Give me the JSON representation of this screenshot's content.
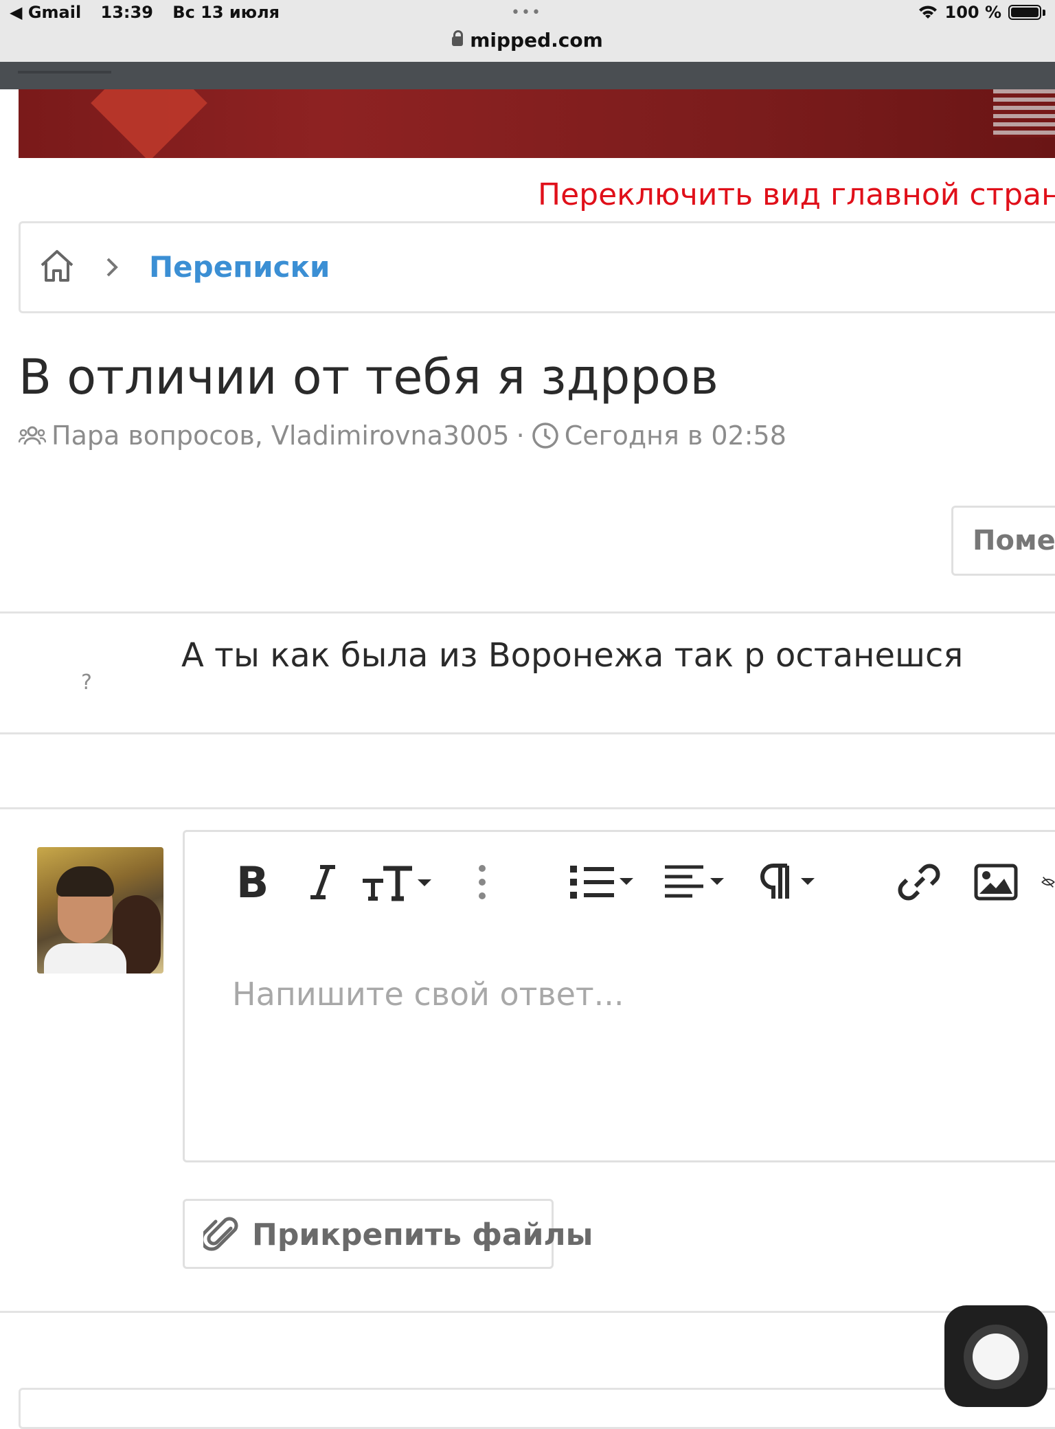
{
  "status_bar": {
    "back_app": "◀ Gmail",
    "time": "13:39",
    "date": "Вс 13 июля",
    "dots": "•••",
    "battery": "100 %"
  },
  "browser": {
    "url": "mipped.com"
  },
  "header": {
    "switch_view_link": "Переключить вид главной стран"
  },
  "breadcrumb": {
    "item": "Переписки"
  },
  "conversation": {
    "title": "В отличии от тебя я здрров",
    "participants": "Пара вопросов, Vladimirovna3005",
    "separator": "·",
    "time": "Сегодня в 02:58",
    "mark_button": "Помет"
  },
  "message": {
    "avatar_placeholder": "?",
    "text": "А ты как была из Воронежа так р останешся"
  },
  "reply": {
    "placeholder": "Напишите свой ответ...",
    "attach_button": "Прикрепить файлы",
    "toolbar": [
      "bold-icon",
      "italic-icon",
      "text-size-icon",
      "more-options-icon",
      "list-icon",
      "align-icon",
      "paragraph-icon",
      "link-icon",
      "image-icon",
      "hide-icon"
    ]
  },
  "colors": {
    "link": "#3b8fd4",
    "switch_link": "#e0101a",
    "banner": "#8e2222",
    "border": "#e3e3e3"
  }
}
